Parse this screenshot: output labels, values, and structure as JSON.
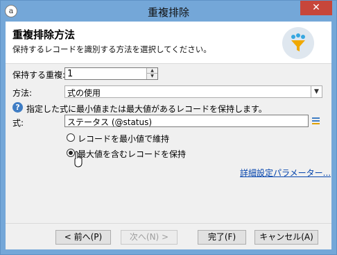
{
  "window": {
    "title": "重複排除",
    "close_glyph": "✕",
    "app_icon_glyph": "a"
  },
  "header": {
    "title": "重複排除方法",
    "subtitle": "保持するレコードを識別する方法を選択してください。",
    "icon": "funnel-filter-icon"
  },
  "form": {
    "keep_label": "保持する重複:",
    "keep_value": "1",
    "method_label": "方法:",
    "method_value": "式の使用",
    "info_text": "指定した式に最小値または最大値があるレコードを保持します。",
    "expression_label": "式:",
    "expression_value": "ステータス (@status)",
    "radio_min": "レコードを最小値で維持",
    "radio_max": "最大値を含むレコードを保持",
    "selected_radio": "max",
    "advanced_link": "詳細設定パラメーター..."
  },
  "buttons": {
    "back": "< 前へ(P)",
    "next": "次へ(N) >",
    "finish": "完了(F)",
    "cancel": "キャンセル(A)"
  },
  "colors": {
    "titlebar": "#74a7d8",
    "close": "#c7463a",
    "link": "#0645ad"
  }
}
